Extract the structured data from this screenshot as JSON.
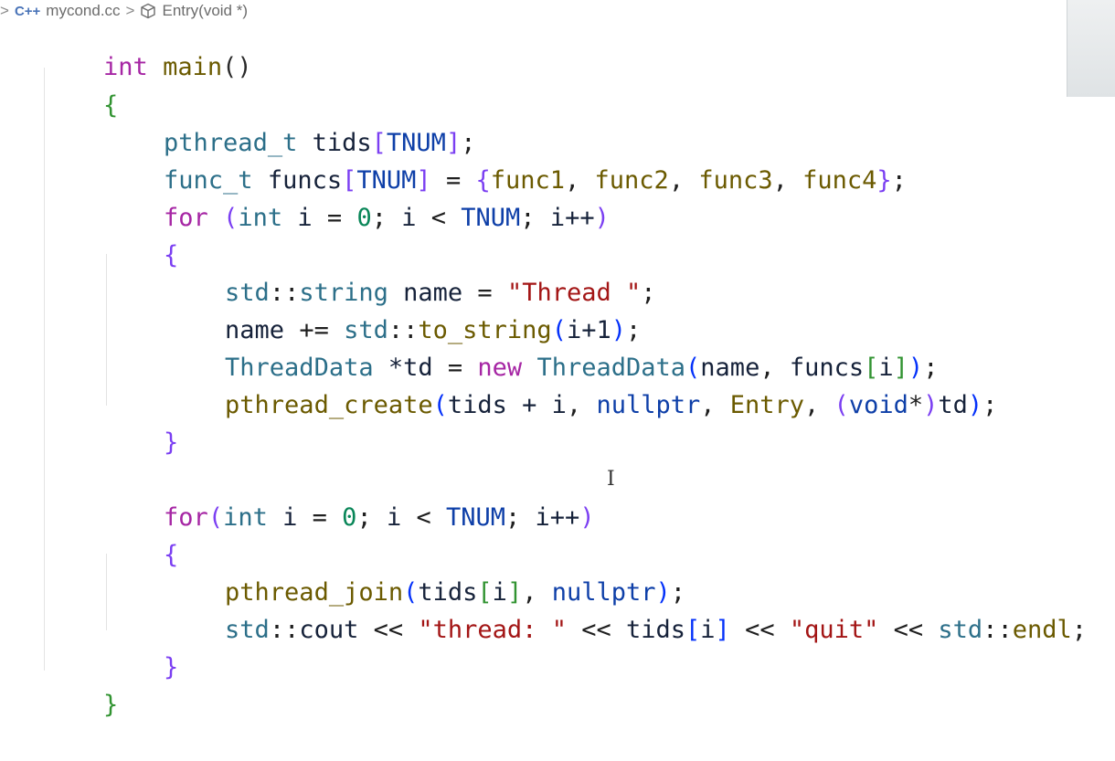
{
  "breadcrumb": {
    "file_name": "mycond.cc",
    "symbol": "Entry(void *)",
    "lang_badge": "C++"
  },
  "code": {
    "l0_kw": "int",
    "l0_fn": "main",
    "l0_paren": "()",
    "l1": "{",
    "l2_type": "pthread_t",
    "l2_var": "tids",
    "l2_macro": "TNUM",
    "l3_type": "func_t",
    "l3_var": "funcs",
    "l3_macro": "TNUM",
    "l3_f1": "func1",
    "l3_f2": "func2",
    "l3_f3": "func3",
    "l3_f4": "func4",
    "l4_kw": "for",
    "l4_int": "int",
    "l4_i": "i",
    "l4_zero": "0",
    "l4_i2": "i",
    "l4_macro": "TNUM",
    "l4_i3": "i++",
    "l5": "{",
    "l6_ns": "std",
    "l6_type": "string",
    "l6_var": "name",
    "l6_str": "\"Thread \"",
    "l7_var": "name",
    "l7_ns": "std",
    "l7_fn": "to_string",
    "l7_arg": "i+1",
    "l8_type": "ThreadData",
    "l8_var": "*td",
    "l8_new": "new",
    "l8_type2": "ThreadData",
    "l8_a1": "name",
    "l8_a2": "funcs",
    "l8_a3": "i",
    "l9_fn": "pthread_create",
    "l9_a1": "tids + i",
    "l9_null": "nullptr",
    "l9_entry": "Entry",
    "l9_cast": "void",
    "l9_td": "td",
    "l10": "}",
    "l12_kw": "for",
    "l12_int": "int",
    "l12_i": "i",
    "l12_zero": "0",
    "l12_i2": "i",
    "l12_macro": "TNUM",
    "l12_i3": "i++",
    "l13": "{",
    "l14_fn": "pthread_join",
    "l14_tids": "tids",
    "l14_i": "i",
    "l14_null": "nullptr",
    "l15_ns": "std",
    "l15_cout": "cout",
    "l15_str1": "\"thread: \"",
    "l15_tids": "tids",
    "l15_i": "i",
    "l15_str2": "\"quit\"",
    "l15_ns2": "std",
    "l15_endl": "endl",
    "l16": "}",
    "l17": "}"
  },
  "colors": {
    "keyword": "#a626a4",
    "type": "#2c6f89",
    "function": "#6b5a00",
    "string": "#a31515",
    "number": "#098658",
    "macro": "#0e3fa8"
  }
}
